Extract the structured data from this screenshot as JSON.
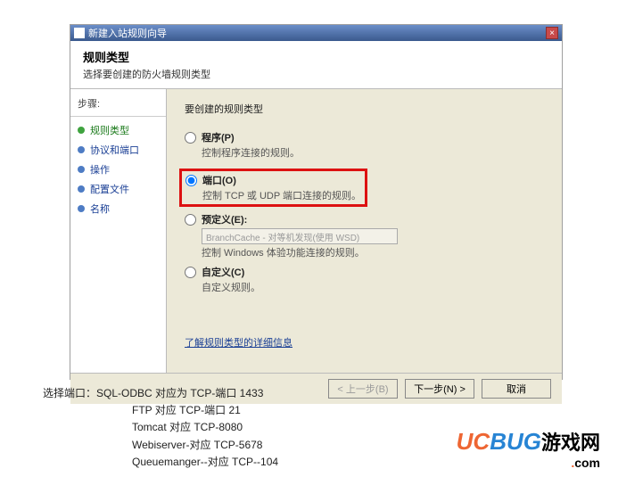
{
  "titlebar": {
    "title": "新建入站规则向导",
    "close": "×"
  },
  "header": {
    "title": "规则类型",
    "subtitle": "选择要创建的防火墙规则类型"
  },
  "sidebar": {
    "heading": "步骤:",
    "items": [
      {
        "label": "规则类型",
        "active": true
      },
      {
        "label": "协议和端口"
      },
      {
        "label": "操作"
      },
      {
        "label": "配置文件"
      },
      {
        "label": "名称"
      }
    ]
  },
  "content": {
    "question": "要创建的规则类型",
    "options": {
      "program": {
        "title": "程序(P)",
        "desc": "控制程序连接的规则。"
      },
      "port": {
        "title": "端口(O)",
        "desc": "控制 TCP 或 UDP 端口连接的规则。"
      },
      "predefined": {
        "title": "预定义(E):",
        "combo": "BranchCache - 对等机发现(使用 WSD)",
        "desc": "控制 Windows 体验功能连接的规则。"
      },
      "custom": {
        "title": "自定义(C)",
        "desc": "自定义规则。"
      }
    },
    "link": "了解规则类型的详细信息"
  },
  "footer": {
    "back": "< 上一步(B)",
    "next": "下一步(N) >",
    "cancel": "取消"
  },
  "notes": {
    "l0": "选择端口：SQL-ODBC 对应为 TCP-端口 1433",
    "l1": "FTP  对应 TCP-端口  21",
    "l2": "Tomcat  对应 TCP-8080",
    "l3": "Webiserver-对应 TCP-5678",
    "l4": "Queuemanger--对应  TCP--104"
  },
  "logo": {
    "text1": "UCBUG",
    "text2": "游戏网",
    "dot": ".",
    "com": "com"
  }
}
